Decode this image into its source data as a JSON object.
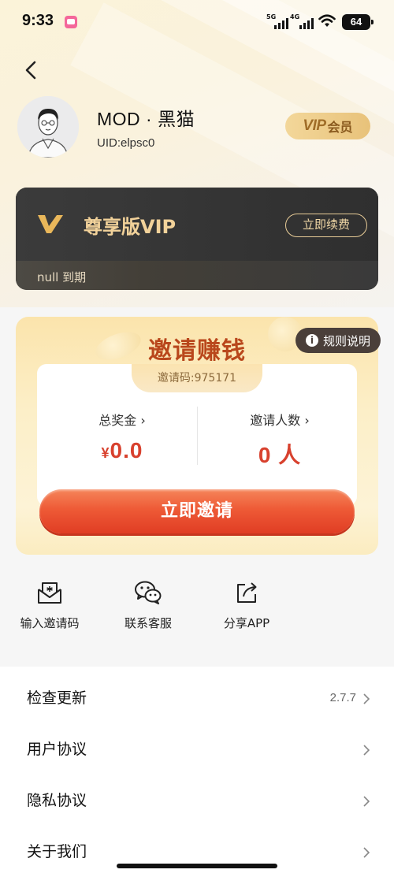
{
  "status_bar": {
    "time": "9:33",
    "network_1": "5G",
    "network_2": "4G",
    "battery": "64"
  },
  "profile": {
    "nickname": "MOD · 黑猫",
    "uid": "UID:elpsc0",
    "vip_word": "VIP",
    "vip_member": "会员"
  },
  "vip_card": {
    "title": "尊享版VIP",
    "renew_label": "立即续费",
    "expire_text": "null 到期"
  },
  "invite": {
    "title": "邀请赚钱",
    "rules_label": "规则说明",
    "invite_code": "邀请码:975171",
    "total_reward_label": "总奖金",
    "total_reward_currency": "¥",
    "total_reward_value": "0.0",
    "invite_count_label": "邀请人数",
    "invite_count_value": "0 人",
    "invite_button": "立即邀请"
  },
  "quick_actions": [
    {
      "label": "输入邀请码",
      "icon": "envelope-icon"
    },
    {
      "label": "联系客服",
      "icon": "wechat-icon"
    },
    {
      "label": "分享APP",
      "icon": "share-icon"
    }
  ],
  "settings": [
    {
      "label": "检查更新",
      "value": "2.7.7"
    },
    {
      "label": "用户协议",
      "value": ""
    },
    {
      "label": "隐私协议",
      "value": ""
    },
    {
      "label": "关于我们",
      "value": ""
    }
  ],
  "colors": {
    "accent": "#e04a2e",
    "gold": "#f2d29a",
    "title_brown": "#b9471c"
  }
}
